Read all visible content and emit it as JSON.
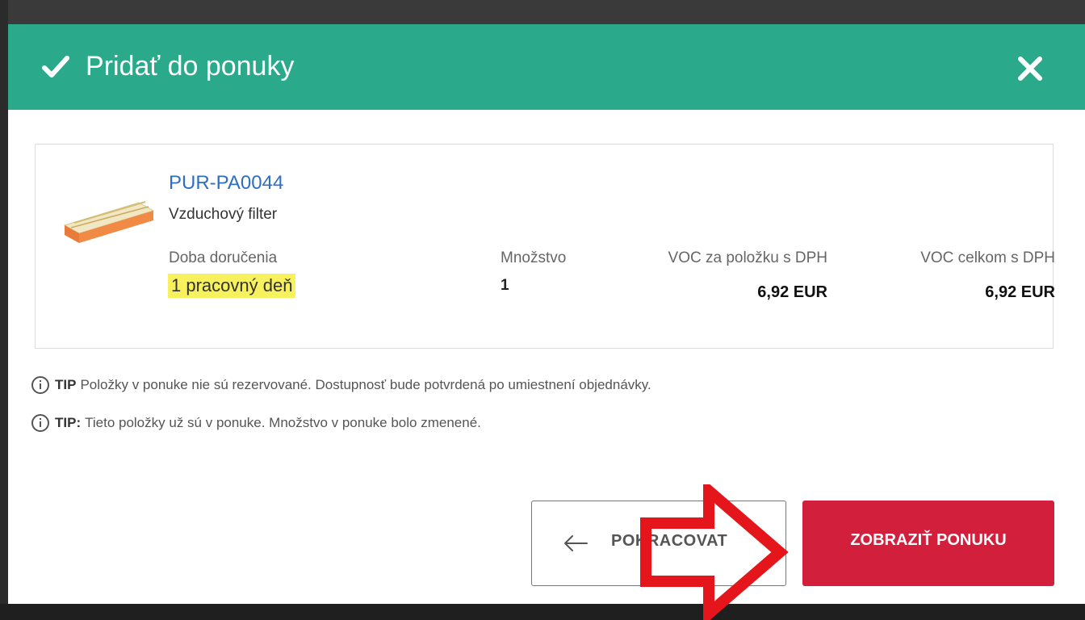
{
  "dialog": {
    "title": "Pridať do ponuky",
    "header_color": "#2aaa8a"
  },
  "product": {
    "code": "PUR-PA0044",
    "name": "Vzduchový filter",
    "delivery_label": "Doba doručenia",
    "delivery_value": "1 pracovný deň",
    "quantity_label": "Množstvo",
    "quantity_value": "1",
    "unit_price_label": "VOC za položku s DPH",
    "unit_price_value": "6,92 EUR",
    "total_price_label": "VOC celkom s DPH",
    "total_price_value": "6,92 EUR"
  },
  "tips": [
    {
      "label": "TIP",
      "text": "Položky v ponuke nie sú rezervované. Dostupnosť bude potvrdená po umiestnení objednávky."
    },
    {
      "label": "TIP:",
      "text": "Tieto položky už sú v ponuke. Množstvo v ponuke bolo zmenené."
    }
  ],
  "buttons": {
    "continue_label": "POKRACOVAT",
    "show_label": "ZOBRAZIŤ PONUKU",
    "show_color": "#d21f3c"
  },
  "icons": {
    "check": "check-icon",
    "close": "close-icon",
    "info": "info-icon",
    "back_arrow": "arrow-left-icon"
  }
}
